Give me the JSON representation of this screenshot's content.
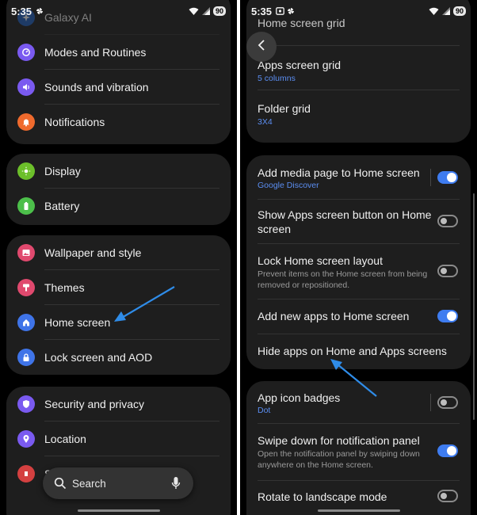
{
  "left_screen": {
    "status": {
      "time": "5:35",
      "battery": "90"
    },
    "groups": [
      {
        "items": [
          {
            "label": "Galaxy AI",
            "icon": "galaxy-ai-icon",
            "color": "#1f5fbf"
          },
          {
            "label": "Modes and Routines",
            "icon": "modes-routines-icon",
            "color": "#7a5af0"
          },
          {
            "label": "Sounds and vibration",
            "icon": "speaker-icon",
            "color": "#7a5af0"
          },
          {
            "label": "Notifications",
            "icon": "bell-icon",
            "color": "#ef6a2d"
          }
        ]
      },
      {
        "items": [
          {
            "label": "Display",
            "icon": "sun-icon",
            "color": "#6cbf2a"
          },
          {
            "label": "Battery",
            "icon": "battery-icon",
            "color": "#4cbf4a"
          }
        ]
      },
      {
        "items": [
          {
            "label": "Wallpaper and style",
            "icon": "image-icon",
            "color": "#e0496e"
          },
          {
            "label": "Themes",
            "icon": "brush-icon",
            "color": "#e0496e"
          },
          {
            "label": "Home screen",
            "icon": "home-icon",
            "color": "#3f74e8"
          },
          {
            "label": "Lock screen and AOD",
            "icon": "lock-icon",
            "color": "#3f74e8"
          }
        ]
      },
      {
        "items": [
          {
            "label": "Security and privacy",
            "icon": "shield-icon",
            "color": "#7a5af0"
          },
          {
            "label": "Location",
            "icon": "location-pin-icon",
            "color": "#7a5af0"
          },
          {
            "label": "S",
            "icon": "safety-icon",
            "color": "#d44040"
          }
        ]
      }
    ],
    "search": {
      "label": "Search"
    }
  },
  "right_screen": {
    "status": {
      "time": "5:35",
      "battery": "90"
    },
    "rows": {
      "home_grid": {
        "title": "Home screen grid"
      },
      "apps_grid": {
        "title": "Apps screen grid",
        "sub": "5 columns"
      },
      "folder_grid": {
        "title": "Folder grid",
        "sub": "3X4"
      },
      "media_page": {
        "title": "Add media page to Home screen",
        "sub": "Google Discover",
        "on": true
      },
      "apps_button": {
        "title": "Show Apps screen button on Home screen",
        "on": false
      },
      "lock_layout": {
        "title": "Lock Home screen layout",
        "sub": "Prevent items on the Home screen from being removed or repositioned.",
        "on": false
      },
      "add_new_apps": {
        "title": "Add new apps to Home screen",
        "on": true
      },
      "hide_apps": {
        "title": "Hide apps on Home and Apps screens"
      },
      "icon_badges": {
        "title": "App icon badges",
        "sub": "Dot",
        "on": false
      },
      "swipe_down": {
        "title": "Swipe down for notification panel",
        "sub": "Open the notification panel by swiping down anywhere on the Home screen.",
        "on": true
      },
      "rotate": {
        "title": "Rotate to landscape mode",
        "on": false
      }
    }
  },
  "colors": {
    "accent_blue": "#3e7cf0",
    "annotation_arrow": "#2f8ce8",
    "card_bg": "#1e1e1e"
  }
}
